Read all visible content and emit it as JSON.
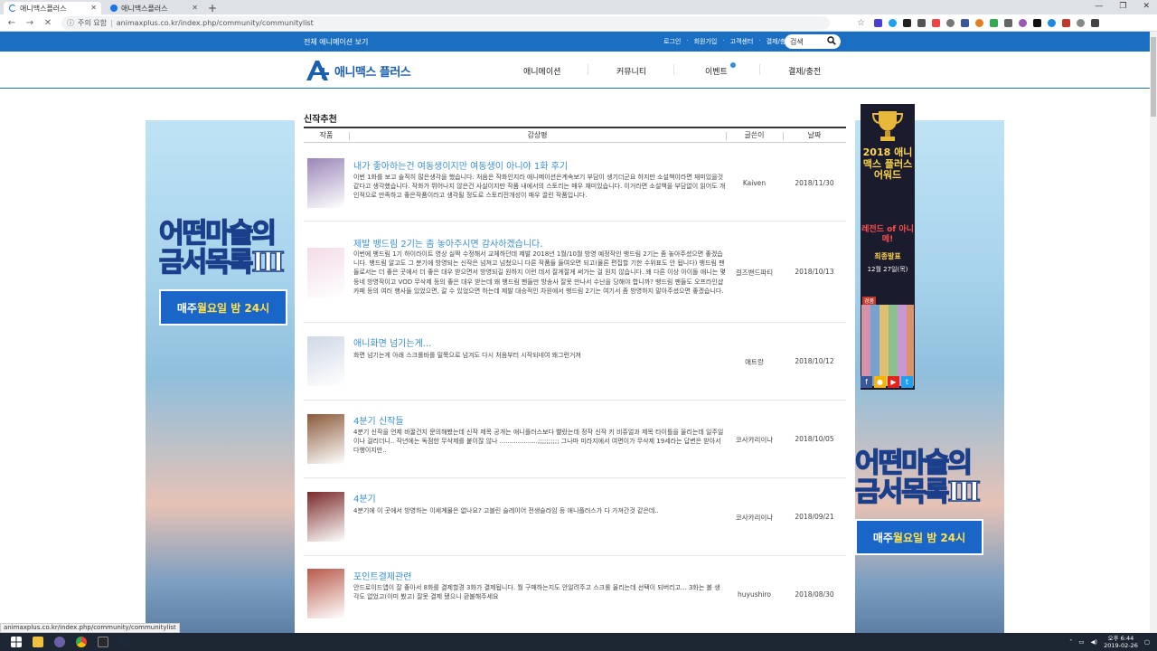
{
  "browser": {
    "tabs": [
      {
        "title": "애니맥스플러스",
        "active": true
      },
      {
        "title": "애니맥스플러스",
        "active": false
      }
    ],
    "security_label": "주의 요함",
    "url": "animaxplus.co.kr/index.php/community/communitylist",
    "status_url": "animaxplus.co.kr/index.php/community/communitylist"
  },
  "header": {
    "all_anime_label": "전체 애니메이션 보기",
    "top_links": [
      "로그인",
      "회원가입",
      "고객센터",
      "결제/충전"
    ],
    "search_placeholder": "검색",
    "logo_text": "애니맥스 플러스",
    "nav": [
      "애니메이션",
      "커뮤니티",
      "이벤트",
      "결제/충전"
    ]
  },
  "page": {
    "section_title": "신작추천",
    "columns": [
      "작품",
      "감상평",
      "글쓴이",
      "날짜"
    ],
    "rows": [
      {
        "title": "내가 좋아하는건 여동생이지만 여동생이 아니야 1화 후기",
        "desc": "이번 1화를 보고 솔직히 많은생각을 했습니다. 처음은 작화인지라 애니메이션은계속보기 부담이 생기더군요 하지만 소설책이라면 재미있을것 같다고 생각했습니다. 작화가 뛰어나지 않은건 사실이지만 작품 내에서의 스토리는 매우 재미있습니다. 이거라면 소설책을 부담없이 읽어도 개인적으로 만족하고 좋은작품이라고 생각될 정도로 스토리전개성이 매우 끌린 작품입니다.",
        "author": "Kaiven",
        "date": "2018/11/30",
        "thumb_color": "#9a86b8"
      },
      {
        "title": "제발 뱅드림 2기는 좀 놓아주시면 감사하겠습니다.",
        "desc": "이번에 뱅드림 1기 하이라이트 영상 실짝 수정해서 교체하던데 제발 2018년 1월/10월 방영 예정작인 뱅드림 2기는 좀 놓아주셨으면 좋겠습니다. 뱅드림 알고도 그 분기에 방영되는 신작은 넘쳐고 넘쳤으니 다른 작품들 들여오면 되고(물론 편집할 기한 수위표도 안 됩니다) 뱅드림 팬들로서는 더 좋은 곳에서 더 좋은 대우 받으면서 방영되길 원하지 이런 데서 잘게잘게 써가는 걸 원치 않습니다. 왜 다른 이상 아이돌 애니는 몇등네 방영작이고 VOD 무삭제 등의 좋은 대우 받는데 왜 뱅드림 팬들만 방송사 잘못 만나서 수난을 당해야 합니까? 뱅드림 팬들도 오프라인샵 카페 등의 여러 행사들 있었으면, 갈 수 있었으면 하는데 제발 대승적인 차원에서 뱅드림 2기는 여기서 좀 방영하지 말아주셨으면 좋겠습니다.",
        "author": "걸즈밴드파티",
        "date": "2018/10/13",
        "thumb_color": "#f3dbe8"
      },
      {
        "title": "애니화면 넘기는게...",
        "desc": "화면 넘기는게 아래 스크롤바를 밀쭉으로 넘겨도 다시 처음부터 시작되네여 왜그런거져",
        "author": "애트랑",
        "date": "2018/10/12",
        "thumb_color": "#cfd8e6"
      },
      {
        "title": "4분기 신작들",
        "desc": "4분기 신작을 언제 바꿀건지 문의해봤는데 신작 제목 공개는 애니플러스보다 빨랐는데 정작 신작 키 비쥬얼과 제목 타이틀을 올리는데 일주일이나 걸리더니.. 작년에는 독점한 무삭제를 붙이잖 않나 ...................;;;;;;;;;; 그나마 미라지에서 여면이가 무삭제 19세라는 답변은 받아서 다행이지만..",
        "author": "코사카리이나",
        "date": "2018/10/05",
        "thumb_color": "#8a5a3a"
      },
      {
        "title": "4분기",
        "desc": "4분기에 이 곳에서 방영하는 이세계물은 없나요? 고블린 슬레이어 전생슬라임 등 애니플러스가 다 가져간것 같은데..",
        "author": "코사카리이나",
        "date": "2018/09/21",
        "thumb_color": "#7a2a2a"
      },
      {
        "title": "포인트결제관련",
        "desc": "안드로이드앱이 잘 좋아서 8화를 결제할경 3화가 결제됩니다. 뭘 구매하는지도 안알려주고 스크롤 올리는데 선택이 되버리고... 3화는 볼 생각도 없었고(이미 봤고) 잘못 결제 됐으니 환불해주세요",
        "author": "huyushiro",
        "date": "2018/08/30",
        "thumb_color": "#b85a4a"
      }
    ]
  },
  "promo": {
    "title_line1": "어떤마술의",
    "title_line2": "금서목록Ⅲ",
    "btn_prefix": "매주 ",
    "btn_highlight": "월요일 밤 24시"
  },
  "award": {
    "title": "2018 애니맥스 플러스 어워드",
    "legend": "레전드 of 아니메!",
    "final": "최종발표",
    "date": "12월 27일(목)",
    "tag": "경품"
  },
  "taskbar": {
    "time": "오후 6:44",
    "date": "2019-02-26"
  }
}
